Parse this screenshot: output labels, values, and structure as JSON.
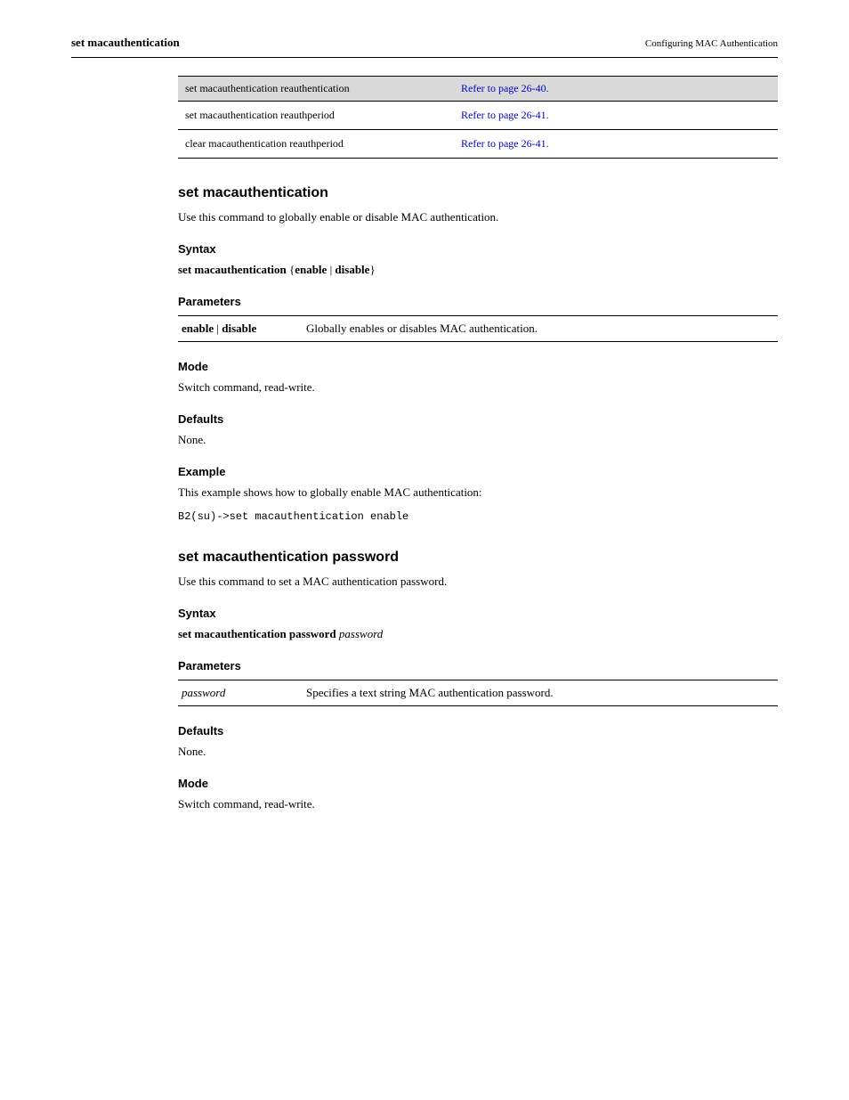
{
  "header": {
    "left": "set macauthentication",
    "right": "Configuring MAC Authentication"
  },
  "xref_table": {
    "rows": [
      {
        "cmd": "set macauthentication reauthentication",
        "page": "Refer to page 26-40."
      },
      {
        "cmd": "set macauthentication reauthperiod",
        "page": "Refer to page 26-41."
      },
      {
        "cmd": "clear macauthentication reauthperiod",
        "page": "Refer to page 26-41."
      }
    ]
  },
  "section1": {
    "title": "set macauthentication",
    "desc": "Use this command to globally enable or disable MAC authentication.",
    "syntax_heading": "Syntax",
    "syntax_bold": "set macauthentication",
    "syntax_part2": " {",
    "syntax_enable": "enable",
    "syntax_pipe": " | ",
    "syntax_disable": "disable",
    "syntax_close": "}",
    "params_heading": "Parameters",
    "param_row": {
      "label_enable": "enable",
      "label_pipe": " | ",
      "label_disable": "disable",
      "desc": "Globally enables or disables MAC authentication."
    },
    "mode_heading": "Mode",
    "mode_text": "Switch command, read-write.",
    "defaults_heading": "Defaults",
    "defaults_text": "None.",
    "example_heading": "Example",
    "example_text": "This example shows how to globally enable MAC authentication:",
    "example_code": "B2(su)->set macauthentication enable"
  },
  "section2": {
    "title": "set macauthentication password",
    "desc": "Use this command to set a MAC authentication password.",
    "syntax_heading": "Syntax",
    "syntax_bold": "set macauthentication password",
    "syntax_space": " ",
    "syntax_italic": "password",
    "params_heading": "Parameters",
    "param_row": {
      "label": "password",
      "desc": "Specifies a text string MAC authentication password."
    },
    "defaults_heading": "Defaults",
    "defaults_text": "None.",
    "mode_heading": "Mode",
    "mode_text": "Switch command, read-write."
  }
}
